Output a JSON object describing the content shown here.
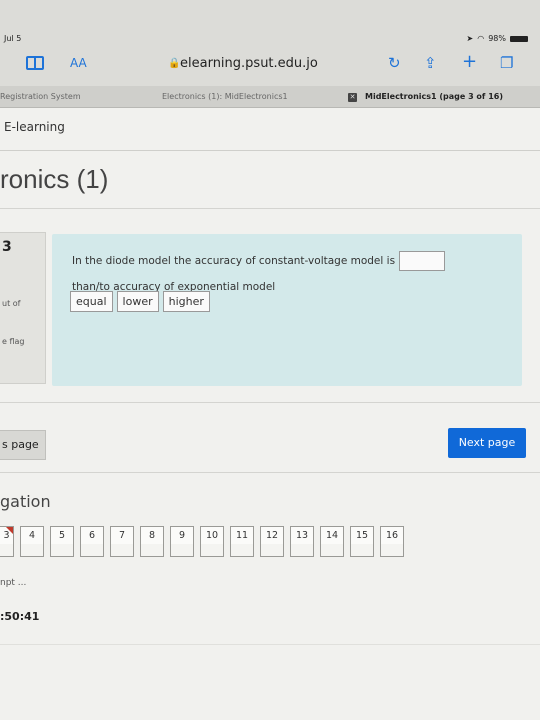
{
  "status_bar": {
    "date": "Jul 5",
    "battery": "98%"
  },
  "browser": {
    "text_size_label": "AA",
    "url": "elearning.psut.edu.jo",
    "tabs": [
      {
        "label": "Registration System"
      },
      {
        "label": "Electronics (1): MidElectronics1"
      },
      {
        "label": "MidElectronics1 (page 3 of 16)"
      }
    ]
  },
  "site": {
    "title": "E-learning",
    "course_title": "ronics (1)"
  },
  "question": {
    "number": "3",
    "marks_text": "ut of",
    "flag_text": "e flag",
    "text_before": "In the diode model the accuracy of constant-voltage model is",
    "text_after": "than/to accuracy of exponential model",
    "options": [
      "equal",
      "lower",
      "higher"
    ]
  },
  "buttons": {
    "previous": "s page",
    "next": "Next page"
  },
  "navigation": {
    "title": "gation",
    "cells": [
      "3",
      "4",
      "5",
      "6",
      "7",
      "8",
      "9",
      "10",
      "11",
      "12",
      "13",
      "14",
      "15",
      "16"
    ],
    "attempt_text": "npt ...",
    "timer": ":50:41"
  }
}
